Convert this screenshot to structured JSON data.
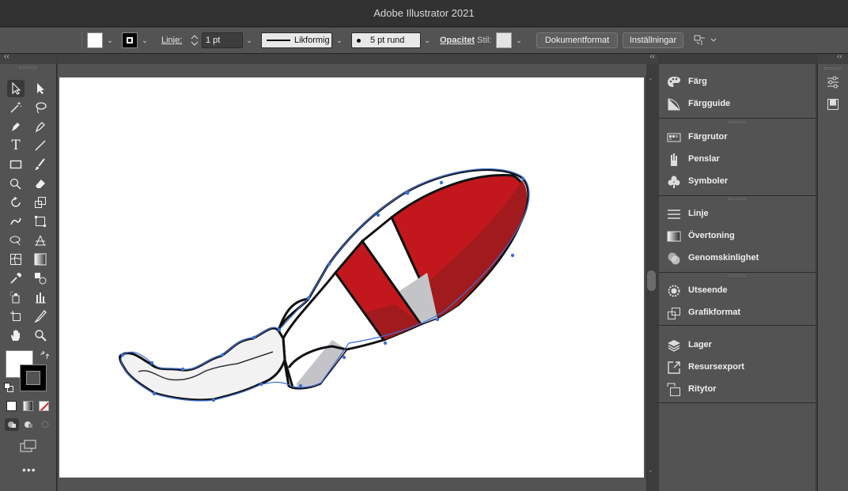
{
  "app": {
    "title": "Adobe Illustrator 2021"
  },
  "controlbar": {
    "stroke_label": "Linje:",
    "stroke_weight": "1 pt",
    "profile_label": "Likformig",
    "brush_label": "5 pt rund",
    "opacity_label": "Opacitet",
    "style_label": "Stil:",
    "doc_format_button": "Dokumentformat",
    "prefs_button": "Inställningar"
  },
  "panels": {
    "groups": [
      {
        "items": [
          {
            "label": "Färg",
            "icon": "palette-icon"
          },
          {
            "label": "Färgguide",
            "icon": "color-guide-icon"
          }
        ]
      },
      {
        "items": [
          {
            "label": "Färgrutor",
            "icon": "swatches-icon"
          },
          {
            "label": "Penslar",
            "icon": "brushes-icon"
          },
          {
            "label": "Symboler",
            "icon": "symbols-icon"
          }
        ]
      },
      {
        "items": [
          {
            "label": "Linje",
            "icon": "stroke-icon"
          },
          {
            "label": "Övertoning",
            "icon": "gradient-icon"
          },
          {
            "label": "Genomskinlighet",
            "icon": "transparency-icon"
          }
        ]
      },
      {
        "items": [
          {
            "label": "Utseende",
            "icon": "appearance-icon"
          },
          {
            "label": "Grafikformat",
            "icon": "graphic-styles-icon"
          }
        ]
      },
      {
        "items": [
          {
            "label": "Lager",
            "icon": "layers-icon"
          },
          {
            "label": "Resursexport",
            "icon": "asset-export-icon"
          },
          {
            "label": "Ritytor",
            "icon": "artboards-icon"
          }
        ]
      }
    ]
  },
  "colors": {
    "rocket_red": "#c3171e",
    "rocket_red_dark": "#a11a1d",
    "body_grey": "#c4c4c8",
    "outline": "#111111",
    "selection": "#3b6fd4"
  }
}
